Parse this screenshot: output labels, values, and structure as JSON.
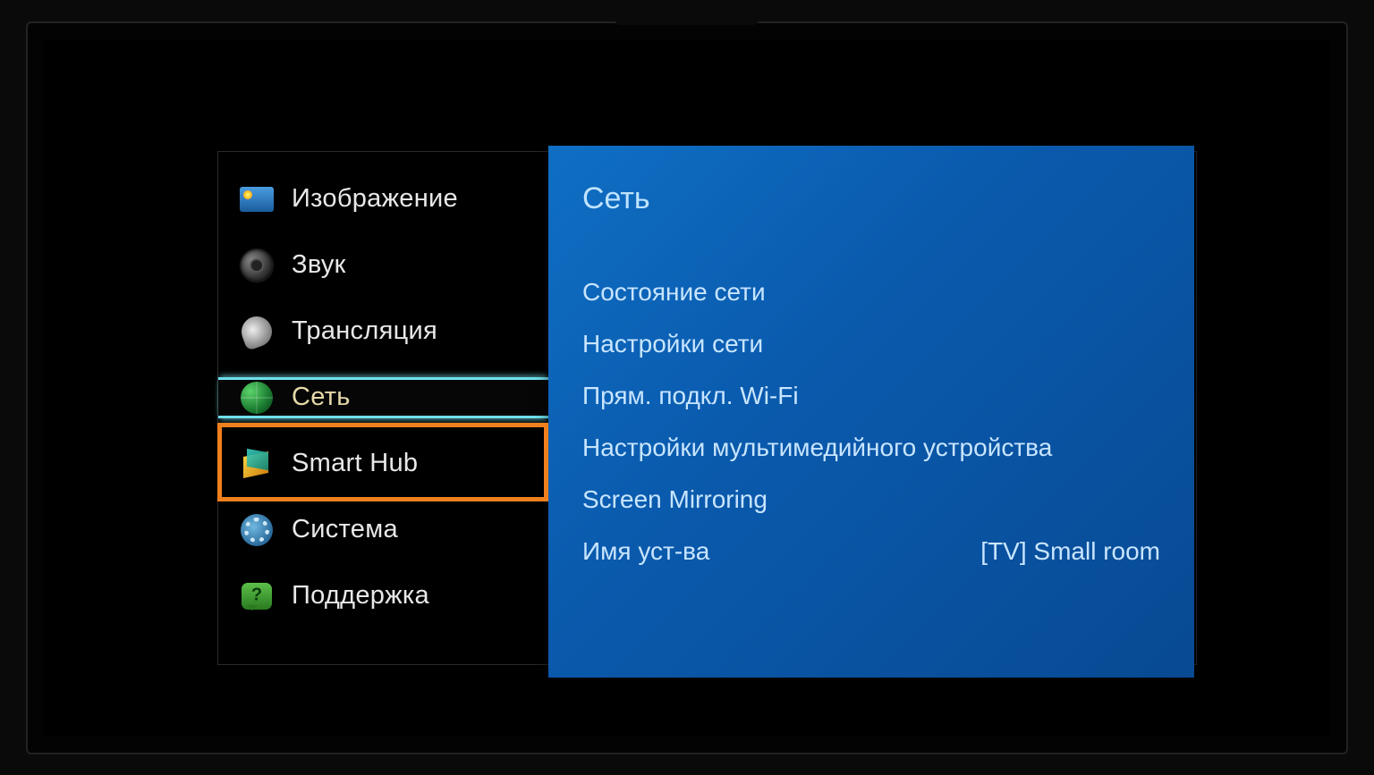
{
  "sidebar": {
    "items": [
      {
        "label": "Изображение",
        "icon": "picture"
      },
      {
        "label": "Звук",
        "icon": "sound"
      },
      {
        "label": "Трансляция",
        "icon": "broadcast"
      },
      {
        "label": "Сеть",
        "icon": "network",
        "selected": true
      },
      {
        "label": "Smart Hub",
        "icon": "smarthub"
      },
      {
        "label": "Система",
        "icon": "system"
      },
      {
        "label": "Поддержка",
        "icon": "support"
      }
    ]
  },
  "panel": {
    "title": "Сеть",
    "items": [
      {
        "label": "Состояние сети"
      },
      {
        "label": "Настройки сети"
      },
      {
        "label": "Прям. подкл. Wi-Fi"
      },
      {
        "label": "Настройки мультимедийного устройства"
      },
      {
        "label": "Screen Mirroring"
      },
      {
        "label": "Имя уст-ва",
        "value": "[TV] Small room"
      }
    ]
  }
}
